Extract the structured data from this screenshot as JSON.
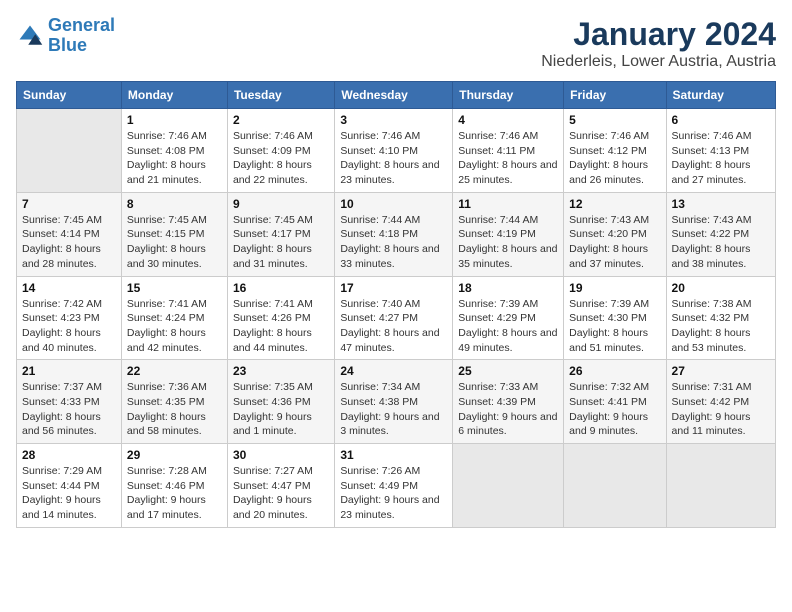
{
  "logo": {
    "line1": "General",
    "line2": "Blue"
  },
  "title": "January 2024",
  "subtitle": "Niederleis, Lower Austria, Austria",
  "weekdays": [
    "Sunday",
    "Monday",
    "Tuesday",
    "Wednesday",
    "Thursday",
    "Friday",
    "Saturday"
  ],
  "weeks": [
    [
      {
        "day": "",
        "sunrise": "",
        "sunset": "",
        "daylight": ""
      },
      {
        "day": "1",
        "sunrise": "Sunrise: 7:46 AM",
        "sunset": "Sunset: 4:08 PM",
        "daylight": "Daylight: 8 hours and 21 minutes."
      },
      {
        "day": "2",
        "sunrise": "Sunrise: 7:46 AM",
        "sunset": "Sunset: 4:09 PM",
        "daylight": "Daylight: 8 hours and 22 minutes."
      },
      {
        "day": "3",
        "sunrise": "Sunrise: 7:46 AM",
        "sunset": "Sunset: 4:10 PM",
        "daylight": "Daylight: 8 hours and 23 minutes."
      },
      {
        "day": "4",
        "sunrise": "Sunrise: 7:46 AM",
        "sunset": "Sunset: 4:11 PM",
        "daylight": "Daylight: 8 hours and 25 minutes."
      },
      {
        "day": "5",
        "sunrise": "Sunrise: 7:46 AM",
        "sunset": "Sunset: 4:12 PM",
        "daylight": "Daylight: 8 hours and 26 minutes."
      },
      {
        "day": "6",
        "sunrise": "Sunrise: 7:46 AM",
        "sunset": "Sunset: 4:13 PM",
        "daylight": "Daylight: 8 hours and 27 minutes."
      }
    ],
    [
      {
        "day": "7",
        "sunrise": "Sunrise: 7:45 AM",
        "sunset": "Sunset: 4:14 PM",
        "daylight": "Daylight: 8 hours and 28 minutes."
      },
      {
        "day": "8",
        "sunrise": "Sunrise: 7:45 AM",
        "sunset": "Sunset: 4:15 PM",
        "daylight": "Daylight: 8 hours and 30 minutes."
      },
      {
        "day": "9",
        "sunrise": "Sunrise: 7:45 AM",
        "sunset": "Sunset: 4:17 PM",
        "daylight": "Daylight: 8 hours and 31 minutes."
      },
      {
        "day": "10",
        "sunrise": "Sunrise: 7:44 AM",
        "sunset": "Sunset: 4:18 PM",
        "daylight": "Daylight: 8 hours and 33 minutes."
      },
      {
        "day": "11",
        "sunrise": "Sunrise: 7:44 AM",
        "sunset": "Sunset: 4:19 PM",
        "daylight": "Daylight: 8 hours and 35 minutes."
      },
      {
        "day": "12",
        "sunrise": "Sunrise: 7:43 AM",
        "sunset": "Sunset: 4:20 PM",
        "daylight": "Daylight: 8 hours and 37 minutes."
      },
      {
        "day": "13",
        "sunrise": "Sunrise: 7:43 AM",
        "sunset": "Sunset: 4:22 PM",
        "daylight": "Daylight: 8 hours and 38 minutes."
      }
    ],
    [
      {
        "day": "14",
        "sunrise": "Sunrise: 7:42 AM",
        "sunset": "Sunset: 4:23 PM",
        "daylight": "Daylight: 8 hours and 40 minutes."
      },
      {
        "day": "15",
        "sunrise": "Sunrise: 7:41 AM",
        "sunset": "Sunset: 4:24 PM",
        "daylight": "Daylight: 8 hours and 42 minutes."
      },
      {
        "day": "16",
        "sunrise": "Sunrise: 7:41 AM",
        "sunset": "Sunset: 4:26 PM",
        "daylight": "Daylight: 8 hours and 44 minutes."
      },
      {
        "day": "17",
        "sunrise": "Sunrise: 7:40 AM",
        "sunset": "Sunset: 4:27 PM",
        "daylight": "Daylight: 8 hours and 47 minutes."
      },
      {
        "day": "18",
        "sunrise": "Sunrise: 7:39 AM",
        "sunset": "Sunset: 4:29 PM",
        "daylight": "Daylight: 8 hours and 49 minutes."
      },
      {
        "day": "19",
        "sunrise": "Sunrise: 7:39 AM",
        "sunset": "Sunset: 4:30 PM",
        "daylight": "Daylight: 8 hours and 51 minutes."
      },
      {
        "day": "20",
        "sunrise": "Sunrise: 7:38 AM",
        "sunset": "Sunset: 4:32 PM",
        "daylight": "Daylight: 8 hours and 53 minutes."
      }
    ],
    [
      {
        "day": "21",
        "sunrise": "Sunrise: 7:37 AM",
        "sunset": "Sunset: 4:33 PM",
        "daylight": "Daylight: 8 hours and 56 minutes."
      },
      {
        "day": "22",
        "sunrise": "Sunrise: 7:36 AM",
        "sunset": "Sunset: 4:35 PM",
        "daylight": "Daylight: 8 hours and 58 minutes."
      },
      {
        "day": "23",
        "sunrise": "Sunrise: 7:35 AM",
        "sunset": "Sunset: 4:36 PM",
        "daylight": "Daylight: 9 hours and 1 minute."
      },
      {
        "day": "24",
        "sunrise": "Sunrise: 7:34 AM",
        "sunset": "Sunset: 4:38 PM",
        "daylight": "Daylight: 9 hours and 3 minutes."
      },
      {
        "day": "25",
        "sunrise": "Sunrise: 7:33 AM",
        "sunset": "Sunset: 4:39 PM",
        "daylight": "Daylight: 9 hours and 6 minutes."
      },
      {
        "day": "26",
        "sunrise": "Sunrise: 7:32 AM",
        "sunset": "Sunset: 4:41 PM",
        "daylight": "Daylight: 9 hours and 9 minutes."
      },
      {
        "day": "27",
        "sunrise": "Sunrise: 7:31 AM",
        "sunset": "Sunset: 4:42 PM",
        "daylight": "Daylight: 9 hours and 11 minutes."
      }
    ],
    [
      {
        "day": "28",
        "sunrise": "Sunrise: 7:29 AM",
        "sunset": "Sunset: 4:44 PM",
        "daylight": "Daylight: 9 hours and 14 minutes."
      },
      {
        "day": "29",
        "sunrise": "Sunrise: 7:28 AM",
        "sunset": "Sunset: 4:46 PM",
        "daylight": "Daylight: 9 hours and 17 minutes."
      },
      {
        "day": "30",
        "sunrise": "Sunrise: 7:27 AM",
        "sunset": "Sunset: 4:47 PM",
        "daylight": "Daylight: 9 hours and 20 minutes."
      },
      {
        "day": "31",
        "sunrise": "Sunrise: 7:26 AM",
        "sunset": "Sunset: 4:49 PM",
        "daylight": "Daylight: 9 hours and 23 minutes."
      },
      {
        "day": "",
        "sunrise": "",
        "sunset": "",
        "daylight": ""
      },
      {
        "day": "",
        "sunrise": "",
        "sunset": "",
        "daylight": ""
      },
      {
        "day": "",
        "sunrise": "",
        "sunset": "",
        "daylight": ""
      }
    ]
  ]
}
